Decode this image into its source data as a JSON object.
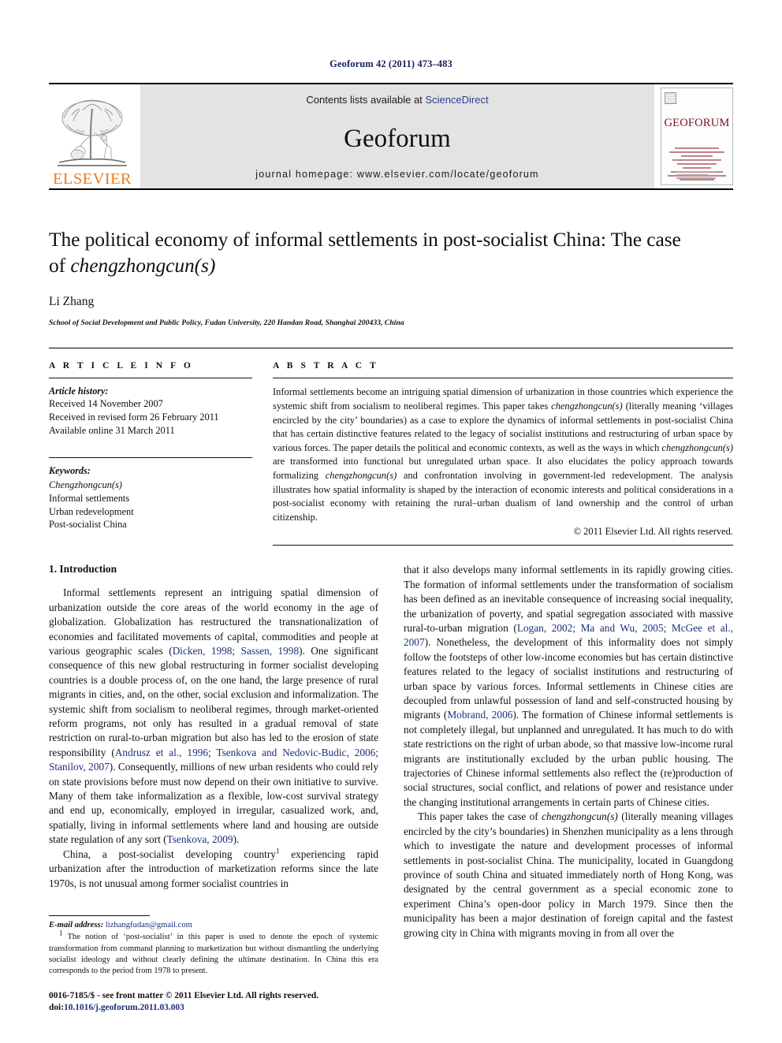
{
  "running_head": "Geoforum 42 (2011) 473–483",
  "masthead": {
    "publisher_logo_label": "ELSEVIER",
    "contents_prefix": "Contents lists available at ",
    "contents_link": "ScienceDirect",
    "journal_title": "Geoforum",
    "homepage": "journal homepage: www.elsevier.com/locate/geoforum",
    "cover_title": "GEOFORUM",
    "link_color": "#2a3d8f",
    "logo_color": "#f07d19",
    "cover_title_color": "#7a1220"
  },
  "article": {
    "title_line1": "The political economy of informal settlements in post-socialist China: The case",
    "title_line2_prefix": "of ",
    "title_line2_italic": "chengzhongcun(s)",
    "author": "Li Zhang",
    "affiliation": "School of Social Development and Public Policy, Fudan University, 220 Handan Road, Shanghai 200433, China"
  },
  "article_info": {
    "heading": "A R T I C L E  I N F O",
    "history_label": "Article history:",
    "history": [
      "Received 14 November 2007",
      "Received in revised form 26 February 2011",
      "Available online 31 March 2011"
    ],
    "keywords_label": "Keywords:",
    "keywords": [
      "Chengzhongcun(s)",
      "Informal settlements",
      "Urban redevelopment",
      "Post-socialist China"
    ]
  },
  "abstract": {
    "heading": "A B S T R A C T",
    "part1": "Informal settlements become an intriguing spatial dimension of urbanization in those countries which experience the systemic shift from socialism to neoliberal regimes. This paper takes ",
    "italic1": "chengzhongcun(s)",
    "part2": " (literally meaning ‘villages encircled by the city’ boundaries) as a case to explore the dynamics of informal settlements in post-socialist China that has certain distinctive features related to the legacy of socialist institutions and restructuring of urban space by various forces. The paper details the political and economic contexts, as well as the ways in which ",
    "italic2": "chengzhongcun(s)",
    "part3": " are transformed into functional but unregulated urban space. It also elucidates the policy approach towards formalizing ",
    "italic3": "chengzhongcun(s)",
    "part4": " and confrontation involving in government-led redevelopment. The analysis illustrates how spatial informality is shaped by the interaction of economic interests and political considerations in a post-socialist economy with retaining the rural–urban dualism of land ownership and the control of urban citizenship.",
    "copyright": "© 2011 Elsevier Ltd. All rights reserved."
  },
  "body": {
    "section1_heading": "1. Introduction",
    "left": {
      "p1_a": "Informal settlements represent an intriguing spatial dimension of urbanization outside the core areas of the world economy in the age of globalization. Globalization has restructured the transnationalization of economies and facilitated movements of capital, commodities and people at various geographic scales (",
      "p1_cite1": "Dicken, 1998; Sassen, 1998",
      "p1_b": "). One significant consequence of this new global restructuring in former socialist developing countries is a double process of, on the one hand, the large presence of rural migrants in cities, and, on the other, social exclusion and informalization. The systemic shift from socialism to neoliberal regimes, through market-oriented reform programs, not only has resulted in a gradual removal of state restriction on rural-to-urban migration but also has led to the erosion of state responsibility (",
      "p1_cite2": "Andrusz et al., 1996; Tsenkova and Nedovic-Budic, 2006; Stanilov, 2007",
      "p1_c": "). Consequently, millions of new urban residents who could rely on state provisions before must now depend on their own initiative to survive. Many of them take informalization as a flexible, low-cost survival strategy and end up, economically, employed in irregular, casualized work, and, spatially, living in informal settlements where land and housing are outside state regulation of any sort (",
      "p1_cite3": "Tsenkova, 2009",
      "p1_d": ").",
      "p2_a": "China, a post-socialist developing country",
      "p2_sup": "1",
      "p2_b": " experiencing rapid urbanization after the introduction of marketization reforms since the late 1970s, is not unusual among former socialist countries in"
    },
    "right": {
      "p1_a": "that it also develops many informal settlements in its rapidly growing cities. The formation of informal settlements under the transformation of socialism has been defined as an inevitable consequence of increasing social inequality, the urbanization of poverty, and spatial segregation associated with massive rural-to-urban migration (",
      "p1_cite1": "Logan, 2002; Ma and Wu, 2005; McGee et al., 2007",
      "p1_b": "). Nonetheless, the development of this informality does not simply follow the footsteps of other low-income economies but has certain distinctive features related to the legacy of socialist institutions and restructuring of urban space by various forces. Informal settlements in Chinese cities are decoupled from unlawful possession of land and self-constructed housing by migrants (",
      "p1_cite2": "Mobrand, 2006",
      "p1_c": "). The formation of Chinese informal settlements is not completely illegal, but unplanned and unregulated. It has much to do with state restrictions on the right of urban abode, so that massive low-income rural migrants are institutionally excluded by the urban public housing. The trajectories of Chinese informal settlements also reflect the (re)production of social structures, social conflict, and relations of power and resistance under the changing institutional arrangements in certain parts of Chinese cities.",
      "p2_a": "This paper takes the case of ",
      "p2_italic": "chengzhongcun(s)",
      "p2_b": " (literally meaning villages encircled by the city’s boundaries) in Shenzhen municipality as a lens through which to investigate the nature and development processes of informal settlements in post-socialist China. The municipality, located in Guangdong province of south China and situated immediately north of Hong Kong, was designated by the central government as a special economic zone to experiment China’s open-door policy in March 1979. Since then the municipality has been a major destination of foreign capital and the fastest growing city in China with migrants moving in from all over the"
    }
  },
  "footnotes": {
    "email_label": "E-mail address:",
    "email": "lizhangfudan@gmail.com",
    "note_marker": "1",
    "note_text": " The notion of ‘post-socialist’ in this paper is used to denote the epoch of systemic transformation from command planning to marketization but without dismantling the underlying socialist ideology and without clearly defining the ultimate destination. In China this era corresponds to the period from 1978 to present."
  },
  "imprint": {
    "issn_line": "0016-7185/$ - see front matter © 2011 Elsevier Ltd. All rights reserved.",
    "doi_label": "doi:",
    "doi_value": "10.1016/j.geoforum.2011.03.003"
  }
}
